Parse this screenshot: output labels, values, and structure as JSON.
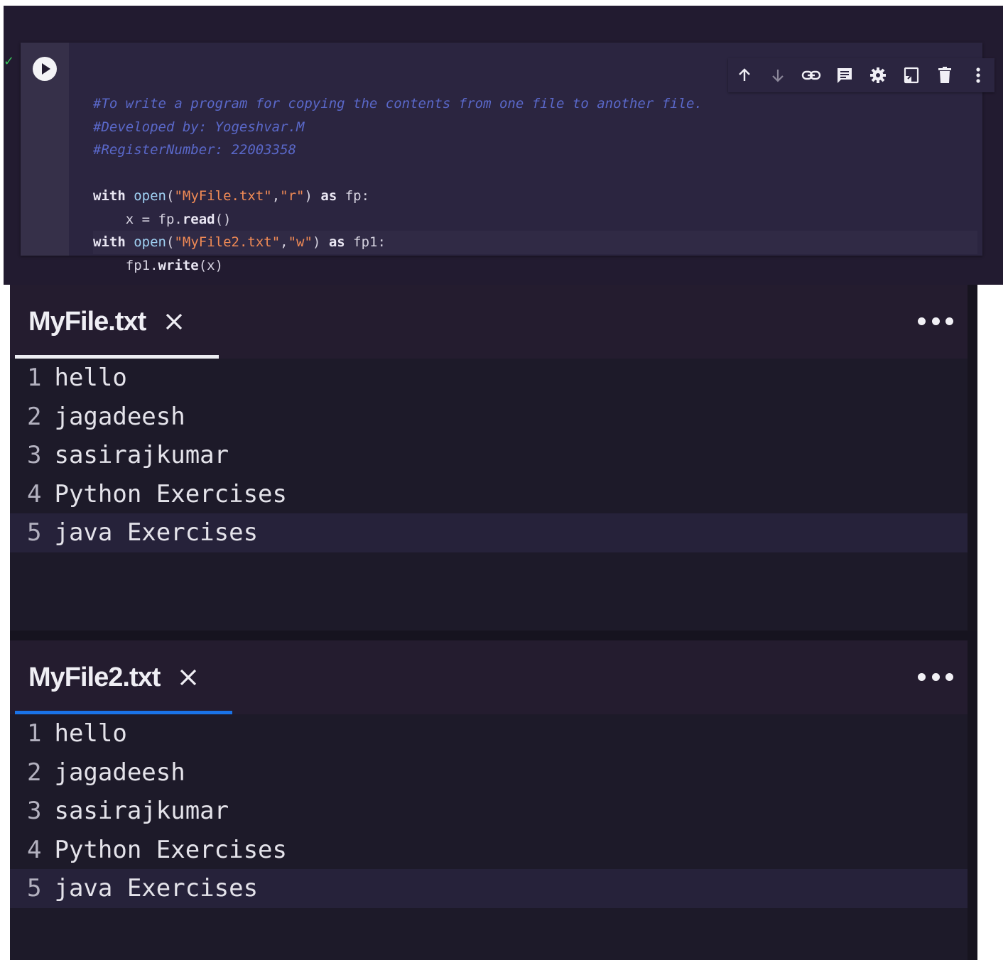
{
  "notebook": {
    "cell": {
      "code_lines": [
        {
          "tokens": [
            {
              "t": "c",
              "v": "#To write a program for copying the contents from one file to another file."
            }
          ]
        },
        {
          "tokens": [
            {
              "t": "c",
              "v": "#Developed by: Yogeshvar.M"
            }
          ]
        },
        {
          "tokens": [
            {
              "t": "c",
              "v": "#RegisterNumber: 22003358"
            }
          ]
        },
        {
          "tokens": []
        },
        {
          "tokens": [
            {
              "t": "kw",
              "v": "with"
            },
            {
              "t": "op",
              "v": " "
            },
            {
              "t": "fn",
              "v": "open"
            },
            {
              "t": "op",
              "v": "("
            },
            {
              "t": "st",
              "v": "\"MyFile.txt\""
            },
            {
              "t": "op",
              "v": ","
            },
            {
              "t": "st",
              "v": "\"r\""
            },
            {
              "t": "op",
              "v": ") "
            },
            {
              "t": "kw",
              "v": "as"
            },
            {
              "t": "id",
              "v": " fp:"
            }
          ]
        },
        {
          "tokens": [
            {
              "t": "ind",
              "v": "    "
            },
            {
              "t": "id",
              "v": "x = fp."
            },
            {
              "t": "kw",
              "v": "read"
            },
            {
              "t": "op",
              "v": "()"
            }
          ]
        },
        {
          "current": true,
          "tokens": [
            {
              "t": "kw",
              "v": "with"
            },
            {
              "t": "op",
              "v": " "
            },
            {
              "t": "fn",
              "v": "open"
            },
            {
              "t": "op",
              "v": "("
            },
            {
              "t": "st",
              "v": "\"MyFile2.txt\""
            },
            {
              "t": "op",
              "v": ","
            },
            {
              "t": "st",
              "v": "\"w\""
            },
            {
              "t": "op",
              "v": ") "
            },
            {
              "t": "kw",
              "v": "as"
            },
            {
              "t": "id",
              "v": " fp1:"
            }
          ]
        },
        {
          "tokens": [
            {
              "t": "ind",
              "v": "    "
            },
            {
              "t": "id",
              "v": "fp1."
            },
            {
              "t": "kw",
              "v": "write"
            },
            {
              "t": "op",
              "v": "(x)"
            }
          ]
        }
      ],
      "exec_status_icon": "check-icon",
      "exec_status_color": "#39c25a",
      "toolbar_icons": [
        "arrow-up-icon",
        "arrow-down-icon",
        "link-icon",
        "comment-icon",
        "gear-icon",
        "mirror-cell-icon",
        "trash-icon",
        "kebab-menu-icon"
      ]
    }
  },
  "files": [
    {
      "tab_label": "MyFile.txt",
      "underline_color": "#ececf2",
      "lines": [
        {
          "num": "1",
          "text": "hello"
        },
        {
          "num": "2",
          "text": "jagadeesh"
        },
        {
          "num": "3",
          "text": "sasirajkumar"
        },
        {
          "num": "4",
          "text": "Python Exercises"
        },
        {
          "num": "5",
          "text": "java Exercises",
          "active": true
        }
      ]
    },
    {
      "tab_label": "MyFile2.txt",
      "underline_color": "#1a73e8",
      "lines": [
        {
          "num": "1",
          "text": "hello"
        },
        {
          "num": "2",
          "text": "jagadeesh"
        },
        {
          "num": "3",
          "text": "sasirajkumar"
        },
        {
          "num": "4",
          "text": "Python Exercises"
        },
        {
          "num": "5",
          "text": "java Exercises",
          "active": true
        }
      ]
    }
  ]
}
